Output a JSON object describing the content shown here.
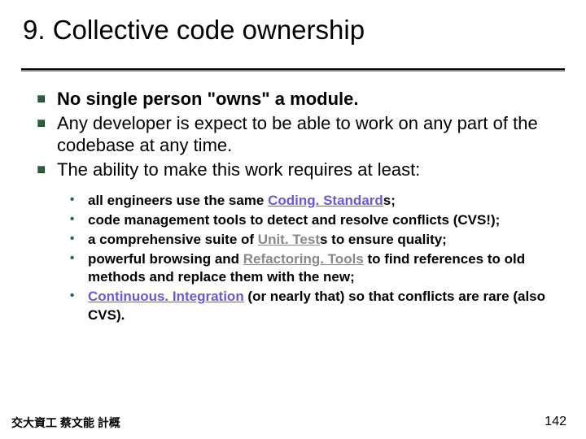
{
  "title": "9. Collective code ownership",
  "bullets": {
    "b1": "No single person \"owns\" a module.",
    "b2": "Any developer is expect to be able to work on any part of the codebase at any time.",
    "b3": "The ability to make this work requires at least:"
  },
  "sub": {
    "s1a": "all engineers use the same ",
    "s1link": "Coding. Standard",
    "s1b": "s;",
    "s2": "code management tools to detect and resolve conflicts (CVS!);",
    "s3a": "a comprehensive suite of ",
    "s3link": "Unit. Test",
    "s3b": "s to ensure quality;",
    "s4a": "powerful browsing and ",
    "s4link": "Refactoring. Tools",
    "s4b": " to find references to old methods and replace them with the new;",
    "s5link": "Continuous. Integration",
    "s5b": " (or nearly that) so that conflicts are rare (also CVS)."
  },
  "footer": {
    "left": "交大資工 蔡文能 計概",
    "page": "142"
  }
}
